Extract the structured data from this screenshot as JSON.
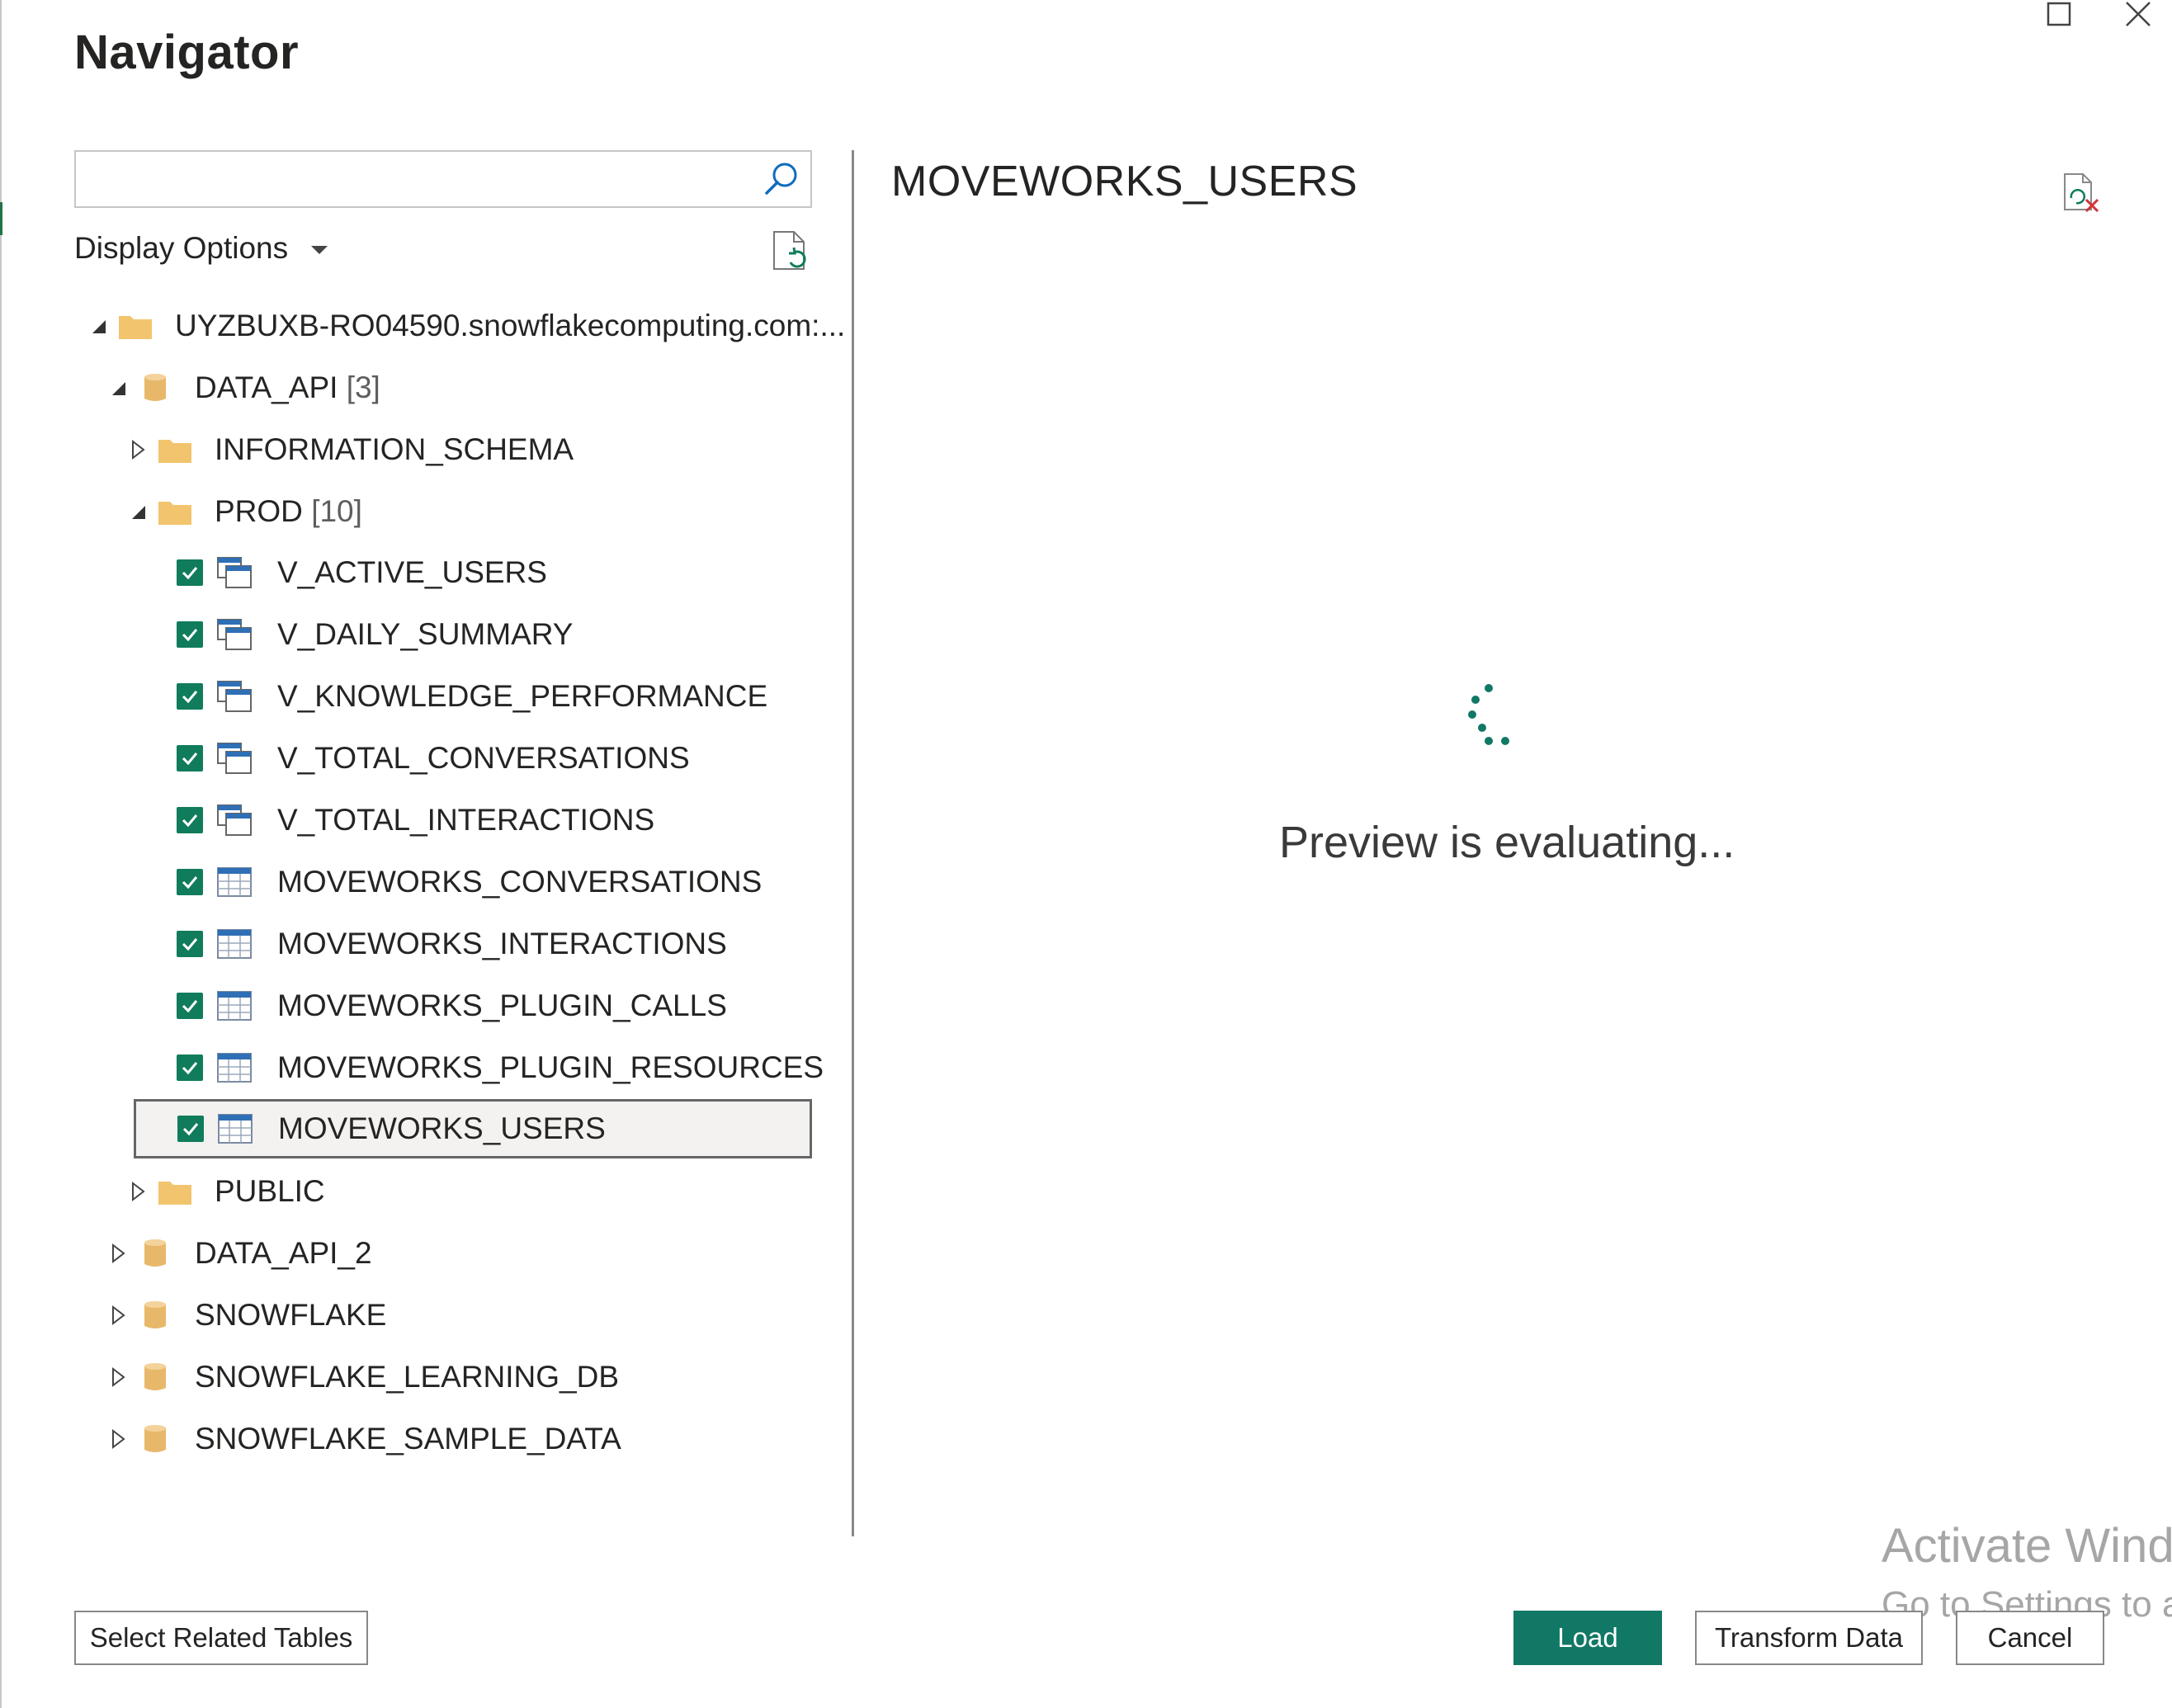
{
  "window": {
    "title": "Navigator",
    "maximize_icon": "maximize-icon",
    "close_icon": "close-icon"
  },
  "search": {
    "value": "",
    "placeholder": "",
    "icon": "search-icon"
  },
  "display_options": {
    "label": "Display Options",
    "icon": "chevron-down-icon"
  },
  "tree": {
    "server": {
      "label": "UYZBUXB-RO04590.snowflakecomputing.com:...",
      "expanded": true
    },
    "db_data_api": {
      "label": "DATA_API",
      "count": "[3]",
      "expanded": true
    },
    "schema_info": {
      "label": "INFORMATION_SCHEMA",
      "expanded": false
    },
    "schema_prod": {
      "label": "PROD",
      "count": "[10]",
      "expanded": true
    },
    "items": [
      {
        "label": "V_ACTIVE_USERS",
        "kind": "view",
        "checked": true
      },
      {
        "label": "V_DAILY_SUMMARY",
        "kind": "view",
        "checked": true
      },
      {
        "label": "V_KNOWLEDGE_PERFORMANCE",
        "kind": "view",
        "checked": true
      },
      {
        "label": "V_TOTAL_CONVERSATIONS",
        "kind": "view",
        "checked": true
      },
      {
        "label": "V_TOTAL_INTERACTIONS",
        "kind": "view",
        "checked": true
      },
      {
        "label": "MOVEWORKS_CONVERSATIONS",
        "kind": "table",
        "checked": true
      },
      {
        "label": "MOVEWORKS_INTERACTIONS",
        "kind": "table",
        "checked": true
      },
      {
        "label": "MOVEWORKS_PLUGIN_CALLS",
        "kind": "table",
        "checked": true
      },
      {
        "label": "MOVEWORKS_PLUGIN_RESOURCES",
        "kind": "table",
        "checked": true
      },
      {
        "label": "MOVEWORKS_USERS",
        "kind": "table",
        "checked": true,
        "selected": true
      }
    ],
    "schema_public": {
      "label": "PUBLIC",
      "expanded": false
    },
    "databases": [
      {
        "label": "DATA_API_2"
      },
      {
        "label": "SNOWFLAKE"
      },
      {
        "label": "SNOWFLAKE_LEARNING_DB"
      },
      {
        "label": "SNOWFLAKE_SAMPLE_DATA"
      }
    ]
  },
  "preview": {
    "title": "MOVEWORKS_USERS",
    "status": "Preview is evaluating..."
  },
  "watermark": {
    "line1": "Activate Wind",
    "line2": "Go to Settings to a"
  },
  "buttons": {
    "select_related": "Select Related Tables",
    "load": "Load",
    "transform": "Transform Data",
    "cancel": "Cancel"
  },
  "colors": {
    "accent": "#117865",
    "checkbox": "#107c5c",
    "folder": "#f2c46d",
    "database": "#e8b86a"
  }
}
